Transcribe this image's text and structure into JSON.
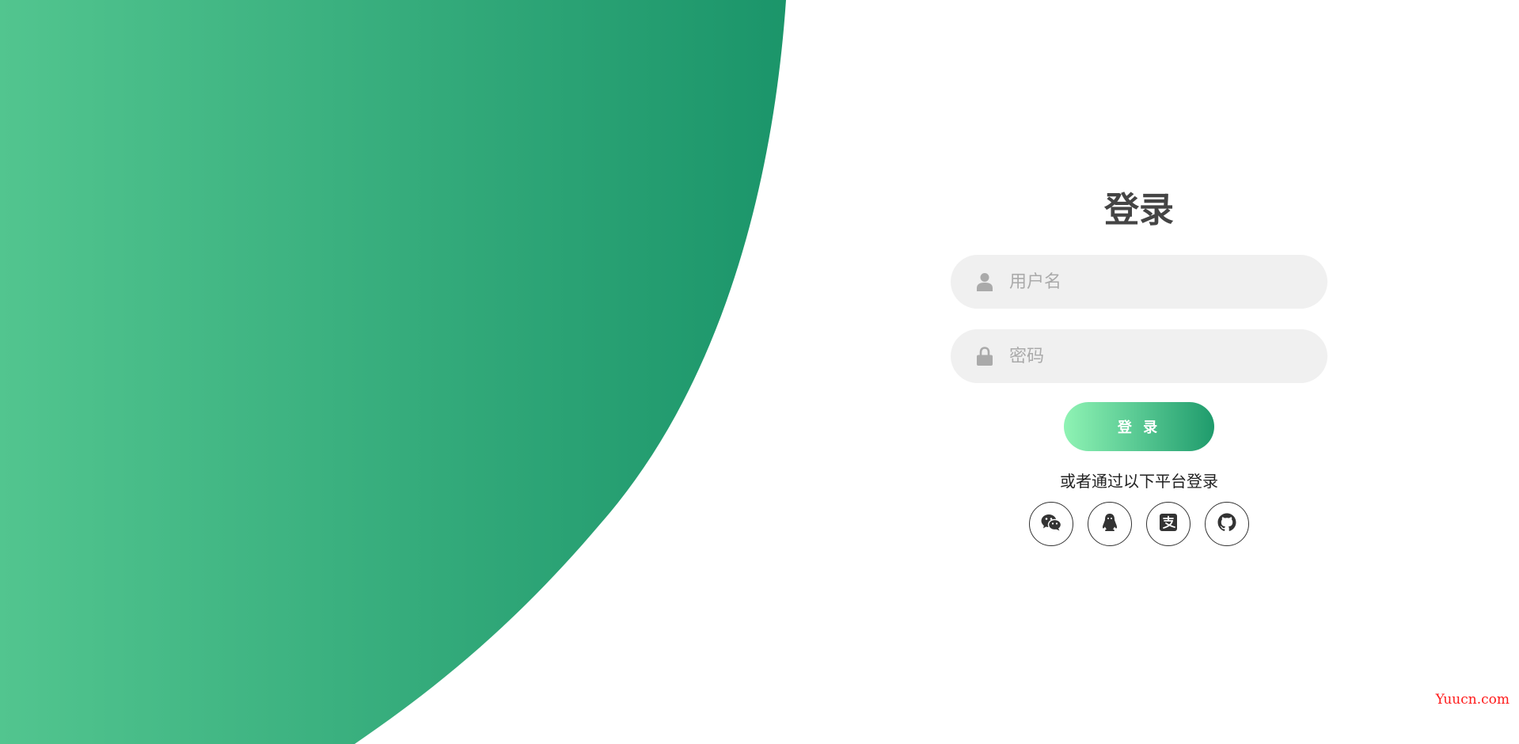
{
  "colors": {
    "gradient_start": "#52c58f",
    "gradient_end": "#1b956a",
    "button_start": "#8ff3b4",
    "button_end": "#1f9b6c",
    "title": "#444444",
    "input_bg": "#f0f0f0",
    "watermark": "#ff1a1a"
  },
  "login": {
    "title": "登录",
    "username": {
      "icon": "user-icon",
      "placeholder": "用户名",
      "value": ""
    },
    "password": {
      "icon": "lock-icon",
      "placeholder": "密码",
      "value": ""
    },
    "submit_label": "登 录",
    "social_text": "或者通过以下平台登录",
    "social": [
      {
        "icon": "wechat-icon"
      },
      {
        "icon": "qq-icon"
      },
      {
        "icon": "alipay-icon"
      },
      {
        "icon": "github-icon"
      }
    ]
  },
  "watermark": "Yuucn.com"
}
